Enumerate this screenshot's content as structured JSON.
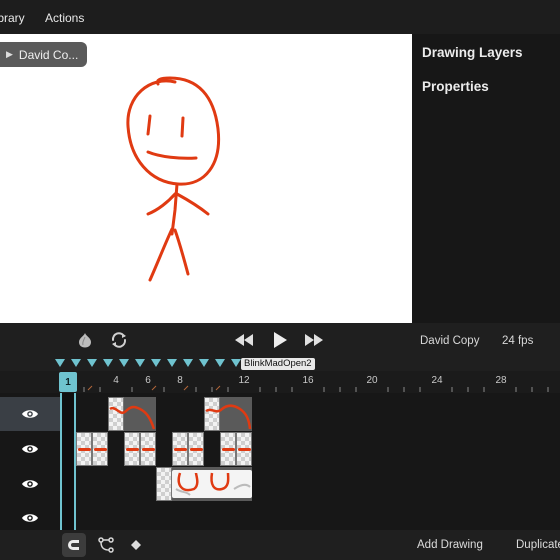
{
  "menu": {
    "library_label": "Library",
    "actions_label": "Actions"
  },
  "canvas": {
    "layer_chip_label": "David Co..."
  },
  "right_panel": {
    "drawing_layers_title": "Drawing Layers",
    "properties_title": "Properties"
  },
  "playbar": {
    "scene_name": "David Copy",
    "fps_label": "24 fps"
  },
  "markers": {
    "marker_label": "BlinkMadOpen2"
  },
  "timeline": {
    "current_frame": "1",
    "tick_labels": [
      "4",
      "6",
      "8",
      "12",
      "16",
      "20",
      "24",
      "28"
    ]
  },
  "bottom_bar": {
    "add_drawing_label": "Add Drawing",
    "duplicate_label": "Duplicate"
  },
  "colors": {
    "accent": "#6fc3cf",
    "stroke": "#e03a12",
    "canvas": "#ffffff"
  }
}
